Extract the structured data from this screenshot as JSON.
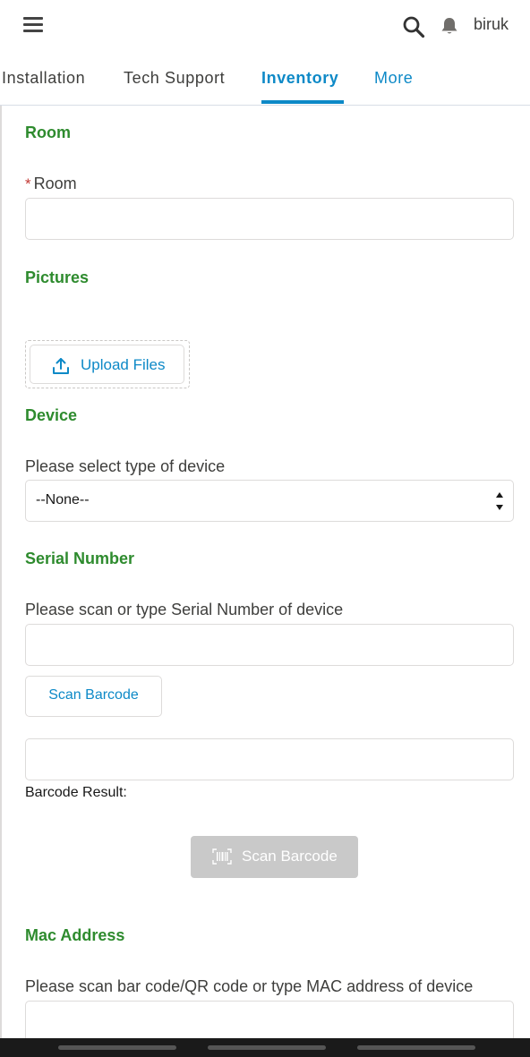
{
  "header": {
    "menu_icon": "hamburger-menu-icon",
    "search_icon": "search-icon",
    "notification_icon": "bell-icon",
    "username": "biruk"
  },
  "tabs": [
    {
      "label": "Installation",
      "active": false
    },
    {
      "label": "Tech Support",
      "active": false
    },
    {
      "label": "Inventory",
      "active": true
    },
    {
      "label": "More",
      "active": false
    }
  ],
  "colors": {
    "accent": "#0d89c7",
    "section_title": "#2e8b2e",
    "required_marker": "#c23934",
    "disabled_button": "#c9c9c9"
  },
  "form": {
    "room": {
      "section_title": "Room",
      "required_marker": "*",
      "label": "Room",
      "value": ""
    },
    "pictures": {
      "section_title": "Pictures",
      "upload_label": "Upload Files",
      "upload_icon": "upload-icon"
    },
    "device": {
      "section_title": "Device",
      "label": "Please select type of device",
      "selected": "--None--"
    },
    "serial_number": {
      "section_title": "Serial Number",
      "label": "Please scan or type Serial Number of device",
      "value": "",
      "scan_button": "Scan Barcode",
      "barcode_result_value": "",
      "barcode_result_label": "Barcode Result:",
      "scan_button_disabled": "Scan Barcode",
      "barcode_icon": "barcode-icon"
    },
    "mac_address": {
      "section_title": "Mac Address",
      "label": "Please scan bar code/QR code or type MAC address of device",
      "value": ""
    }
  }
}
